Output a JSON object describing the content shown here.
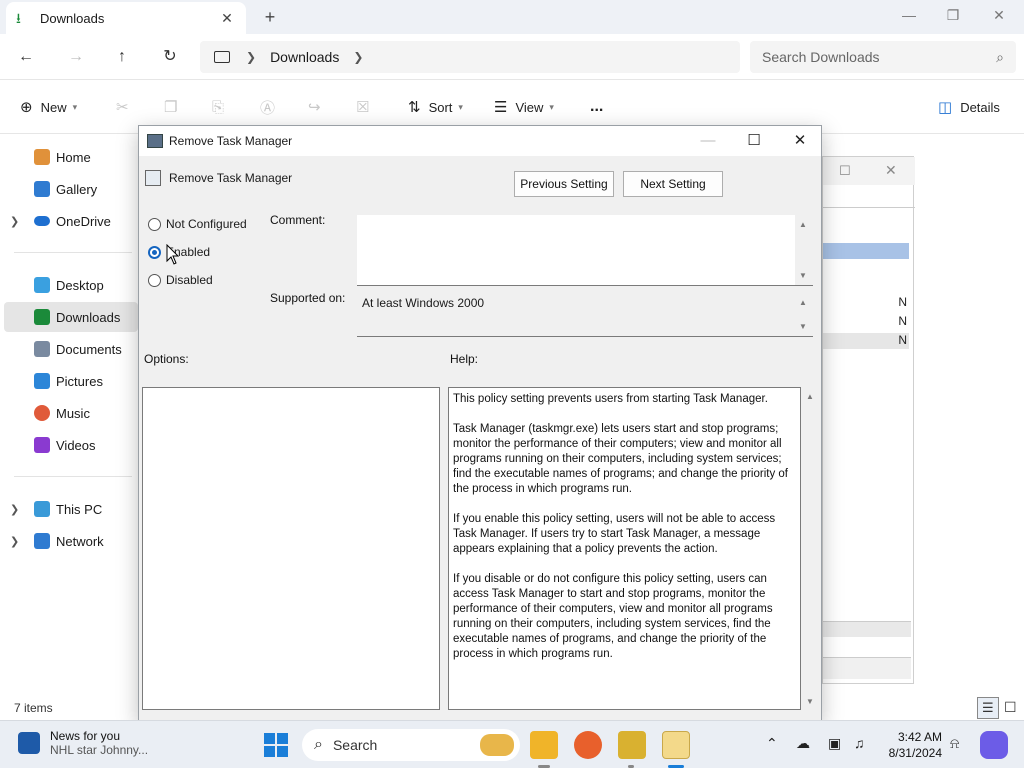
{
  "explorer": {
    "tab_label": "Downloads",
    "address_crumb": "Downloads",
    "search_placeholder": "Search Downloads",
    "cmd": {
      "new": "New",
      "sort": "Sort",
      "view": "View",
      "more": "...",
      "details": "Details"
    },
    "sidebar": [
      {
        "label": "Home",
        "icon": "home-icon",
        "color": "#e0913a"
      },
      {
        "label": "Gallery",
        "icon": "gallery-icon",
        "color": "#2f7bd1"
      },
      {
        "label": "OneDrive",
        "icon": "cloud-icon",
        "color": "#1e6fd0",
        "expandable": true
      },
      {
        "label": "Desktop",
        "icon": "desktop-icon",
        "color": "#3aa0e0"
      },
      {
        "label": "Downloads",
        "icon": "download-icon",
        "color": "#1b8a3a",
        "selected": true
      },
      {
        "label": "Documents",
        "icon": "documents-icon",
        "color": "#7a8aa0"
      },
      {
        "label": "Pictures",
        "icon": "pictures-icon",
        "color": "#2c86d8"
      },
      {
        "label": "Music",
        "icon": "music-icon",
        "color": "#e05a3a"
      },
      {
        "label": "Videos",
        "icon": "videos-icon",
        "color": "#8a3ad0"
      },
      {
        "label": "This PC",
        "icon": "pc-icon",
        "color": "#3a9ad8",
        "expandable": true
      },
      {
        "label": "Network",
        "icon": "network-icon",
        "color": "#2f7bd1",
        "expandable": true
      }
    ],
    "status_count": "7 items",
    "bg_list_letters": [
      "N",
      "N",
      "N"
    ]
  },
  "dialog": {
    "title": "Remove Task Manager",
    "setting_name": "Remove Task Manager",
    "prev_button": "Previous Setting",
    "next_button": "Next Setting",
    "radios": [
      {
        "label": "Not Configured",
        "checked": false
      },
      {
        "label": "Enabled",
        "checked": true
      },
      {
        "label": "Disabled",
        "checked": false
      }
    ],
    "comment_label": "Comment:",
    "supported_label": "Supported on:",
    "supported_value": "At least Windows 2000",
    "options_label": "Options:",
    "help_label": "Help:",
    "help_paragraphs": [
      "This policy setting prevents users from starting Task Manager.",
      "Task Manager (taskmgr.exe) lets users start and stop programs; monitor the performance of their computers; view and monitor all programs running on their computers, including system services; find the executable names of programs; and change the priority of the process in which programs run.",
      "If you enable this policy setting, users will not be able to access Task Manager. If users try to start Task Manager, a message appears explaining that a policy prevents the action.",
      "If you disable or do not configure this policy setting, users can access Task Manager to  start and stop programs, monitor the performance of their computers, view and monitor all programs running on their computers, including system services, find the executable names of programs, and change the priority of the process in which programs run."
    ]
  },
  "taskbar": {
    "news_title": "News for you",
    "news_sub": "NHL star Johnny...",
    "search_label": "Search",
    "time": "3:42 AM",
    "date": "8/31/2024"
  }
}
